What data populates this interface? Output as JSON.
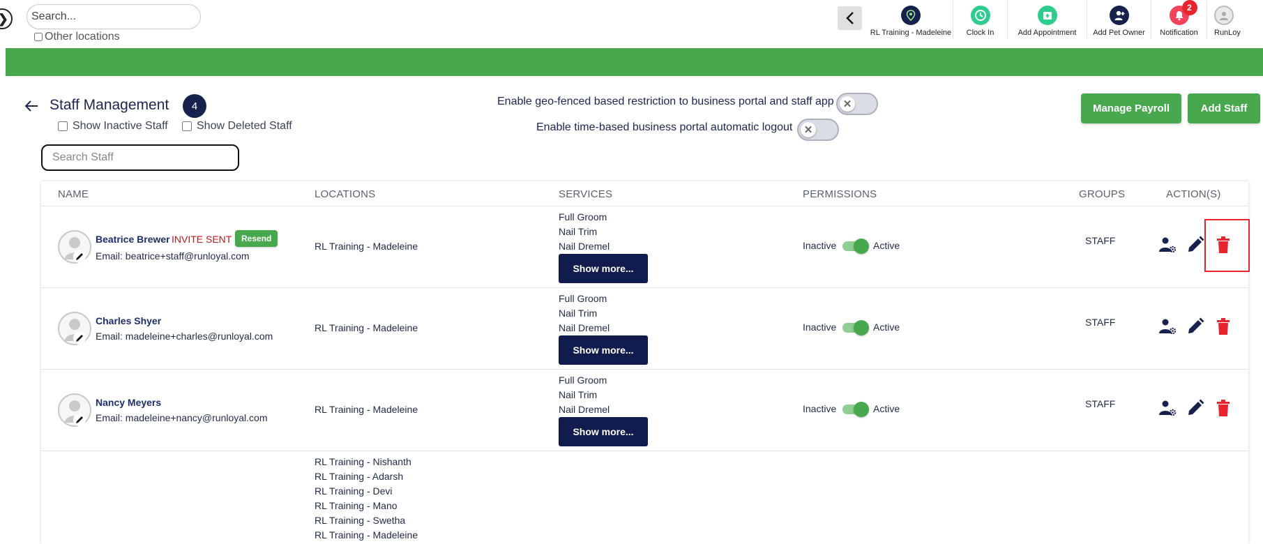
{
  "topbar": {
    "search_placeholder": "Search...",
    "other_locations_label": "Other locations",
    "nav": [
      {
        "label": "RL Training - Madeleine",
        "icon": "location-pin-icon"
      },
      {
        "label": "Clock In",
        "icon": "clock-icon"
      },
      {
        "label": "Add Appointment",
        "icon": "calendar-add-icon"
      },
      {
        "label": "Add Pet Owner",
        "icon": "add-person-icon"
      },
      {
        "label": "Notification",
        "icon": "bell-icon",
        "badge": "2"
      },
      {
        "label": "RunLoy",
        "icon": "user-avatar-icon"
      }
    ]
  },
  "header": {
    "title": "Staff Management",
    "count": "4",
    "show_inactive_label": "Show Inactive Staff",
    "show_deleted_label": "Show Deleted Staff",
    "search_placeholder": "Search Staff",
    "geo_label": "Enable geo-fenced based restriction to business portal and staff app",
    "time_label": "Enable time-based business portal automatic logout",
    "manage_payroll_label": "Manage Payroll",
    "add_staff_label": "Add Staff"
  },
  "table": {
    "columns": [
      "NAME",
      "LOCATIONS",
      "SERVICES",
      "PERMISSIONS",
      "GROUPS",
      "ACTION(S)"
    ],
    "rows": [
      {
        "name": "Beatrice Brewer",
        "invite_status": "INVITE SENT",
        "resend_label": "Resend",
        "email": "Email: beatrice+staff@runloyal.com",
        "location": "RL Training - Madeleine",
        "services": [
          "Full Groom",
          "Nail Trim",
          "Nail Dremel"
        ],
        "show_more_label": "Show more...",
        "perm_inactive": "Inactive",
        "perm_active": "Active",
        "group": "STAFF"
      },
      {
        "name": "Charles Shyer",
        "email": "Email: madeleine+charles@runloyal.com",
        "location": "RL Training - Madeleine",
        "services": [
          "Full Groom",
          "Nail Trim",
          "Nail Dremel"
        ],
        "show_more_label": "Show more...",
        "perm_inactive": "Inactive",
        "perm_active": "Active",
        "group": "STAFF"
      },
      {
        "name": "Nancy Meyers",
        "email": "Email: madeleine+nancy@runloyal.com",
        "location": "RL Training - Madeleine",
        "services": [
          "Full Groom",
          "Nail Trim",
          "Nail Dremel"
        ],
        "show_more_label": "Show more...",
        "perm_inactive": "Inactive",
        "perm_active": "Active",
        "group": "STAFF"
      },
      {
        "locations": [
          "RL Training - Nishanth",
          "RL Training - Adarsh",
          "RL Training - Devi",
          "RL Training - Mano",
          "RL Training - Swetha",
          "RL Training - Madeleine"
        ]
      }
    ]
  },
  "colors": {
    "brand_green": "#47a84d",
    "navy": "#121b4d",
    "delete_red": "#e8242f"
  }
}
